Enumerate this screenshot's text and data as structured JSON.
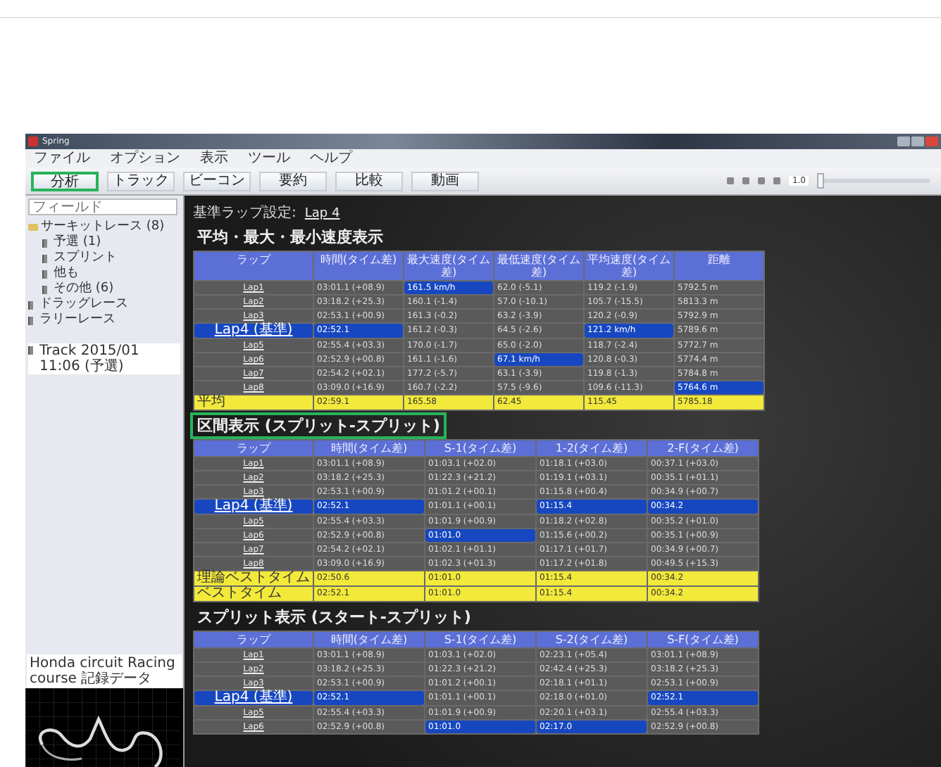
{
  "window": {
    "title": "Spring"
  },
  "menu": [
    "ファイル",
    "オプション",
    "表示",
    "ツール",
    "ヘルプ"
  ],
  "toolbar": {
    "buttons": [
      {
        "label": "分析",
        "outlined": true
      },
      {
        "label": "トラック",
        "outlined": false
      },
      {
        "label": "ビーコン",
        "outlined": false
      },
      {
        "label": "要約",
        "outlined": false
      },
      {
        "label": "比較",
        "outlined": false
      },
      {
        "label": "動画",
        "outlined": false
      }
    ],
    "zoom": "1.0",
    "slider": {
      "level": 0.0
    }
  },
  "sidebar": {
    "search": {
      "placeholder": "フィールド"
    },
    "tree": [
      {
        "label": "サーキットレース (8)",
        "expanded": true,
        "children": [
          {
            "label": "予選 (1)"
          },
          {
            "label": "スプリント"
          },
          {
            "label": "他も"
          },
          {
            "label": "その他 (6)"
          }
        ]
      },
      {
        "label": "ドラッグレース"
      },
      {
        "label": "ラリーレース"
      }
    ],
    "session": "Track 2015/01 11:06 (予選)",
    "map_caption": "Honda circuit Racing course 記録データ"
  },
  "main": {
    "reference_label": "基準ラップ設定:",
    "reference_lap": "Lap 4",
    "sections": [
      {
        "title": "平均・最大・最小速度表示",
        "outlined": false,
        "table": {
          "columns": [
            "ラップ",
            "時間(タイム差)",
            "最大速度(タイム差)",
            "最低速度(タイム差)",
            "平均速度(タイム差)",
            "距離"
          ],
          "rows": [
            {
              "kind": "lap",
              "cells": [
                {
                  "text": "Lap1",
                  "best": false
                },
                {
                  "text": "03:01.1 (+08.9)",
                  "best": false
                },
                {
                  "text": "161.5 km/h",
                  "best": true
                },
                {
                  "text": "62.0 (-5.1)",
                  "best": false
                },
                {
                  "text": "119.2 (-1.9)",
                  "best": false
                },
                {
                  "text": "5792.5 m",
                  "best": false
                }
              ]
            },
            {
              "kind": "lap",
              "cells": [
                {
                  "text": "Lap2",
                  "best": false
                },
                {
                  "text": "03:18.2 (+25.3)",
                  "best": false
                },
                {
                  "text": "160.1 (-1.4)",
                  "best": false
                },
                {
                  "text": "57.0 (-10.1)",
                  "best": false
                },
                {
                  "text": "105.7 (-15.5)",
                  "best": false
                },
                {
                  "text": "5813.3 m",
                  "best": false
                }
              ]
            },
            {
              "kind": "lap",
              "cells": [
                {
                  "text": "Lap3",
                  "best": false
                },
                {
                  "text": "02:53.1 (+00.9)",
                  "best": false
                },
                {
                  "text": "161.3 (-0.2)",
                  "best": false
                },
                {
                  "text": "63.2 (-3.9)",
                  "best": false
                },
                {
                  "text": "120.2 (-0.9)",
                  "best": false
                },
                {
                  "text": "5792.9 m",
                  "best": false
                }
              ]
            },
            {
              "kind": "lap",
              "cells": [
                {
                  "text": "Lap4 (基準)",
                  "best": true
                },
                {
                  "text": "02:52.1",
                  "best": true
                },
                {
                  "text": "161.2 (-0.3)",
                  "best": false
                },
                {
                  "text": "64.5 (-2.6)",
                  "best": false
                },
                {
                  "text": "121.2 km/h",
                  "best": true
                },
                {
                  "text": "5789.6 m",
                  "best": false
                }
              ]
            },
            {
              "kind": "lap",
              "cells": [
                {
                  "text": "Lap5",
                  "best": false
                },
                {
                  "text": "02:55.4 (+03.3)",
                  "best": false
                },
                {
                  "text": "170.0 (-1.7)",
                  "best": false
                },
                {
                  "text": "65.0 (-2.0)",
                  "best": false
                },
                {
                  "text": "118.7 (-2.4)",
                  "best": false
                },
                {
                  "text": "5772.7 m",
                  "best": false
                }
              ]
            },
            {
              "kind": "lap",
              "cells": [
                {
                  "text": "Lap6",
                  "best": false
                },
                {
                  "text": "02:52.9 (+00.8)",
                  "best": false
                },
                {
                  "text": "161.1 (-1.6)",
                  "best": false
                },
                {
                  "text": "67.1 km/h",
                  "best": true
                },
                {
                  "text": "120.8 (-0.3)",
                  "best": false
                },
                {
                  "text": "5774.4 m",
                  "best": false
                }
              ]
            },
            {
              "kind": "lap",
              "cells": [
                {
                  "text": "Lap7",
                  "best": false
                },
                {
                  "text": "02:54.2 (+02.1)",
                  "best": false
                },
                {
                  "text": "177.2 (-5.7)",
                  "best": false
                },
                {
                  "text": "63.1 (-3.9)",
                  "best": false
                },
                {
                  "text": "119.8 (-1.3)",
                  "best": false
                },
                {
                  "text": "5784.8 m",
                  "best": false
                }
              ]
            },
            {
              "kind": "lap",
              "cells": [
                {
                  "text": "Lap8",
                  "best": false
                },
                {
                  "text": "03:09.0 (+16.9)",
                  "best": false
                },
                {
                  "text": "160.7 (-2.2)",
                  "best": false
                },
                {
                  "text": "57.5 (-9.6)",
                  "best": false
                },
                {
                  "text": "109.6 (-11.3)",
                  "best": false
                },
                {
                  "text": "5764.6 m",
                  "best": true
                }
              ]
            },
            {
              "kind": "summary",
              "cells": [
                {
                  "text": "平均",
                  "best": false
                },
                {
                  "text": "02:59.1",
                  "best": false
                },
                {
                  "text": "165.58",
                  "best": false
                },
                {
                  "text": "62.45",
                  "best": false
                },
                {
                  "text": "115.45",
                  "best": false
                },
                {
                  "text": "5785.18",
                  "best": false
                }
              ]
            }
          ]
        }
      },
      {
        "title": "区間表示 (スプリット-スプリット)",
        "outlined": true,
        "table": {
          "columns": [
            "ラップ",
            "時間(タイム差)",
            "S-1(タイム差)",
            "1-2(タイム差)",
            "2-F(タイム差)"
          ],
          "rows": [
            {
              "kind": "lap",
              "cells": [
                {
                  "text": "Lap1",
                  "best": false
                },
                {
                  "text": "03:01.1 (+08.9)",
                  "best": false
                },
                {
                  "text": "01:03.1 (+02.0)",
                  "best": false
                },
                {
                  "text": "01:18.1 (+03.0)",
                  "best": false
                },
                {
                  "text": "00:37.1 (+03.0)",
                  "best": false
                }
              ]
            },
            {
              "kind": "lap",
              "cells": [
                {
                  "text": "Lap2",
                  "best": false
                },
                {
                  "text": "03:18.2 (+25.3)",
                  "best": false
                },
                {
                  "text": "01:22.3 (+21.2)",
                  "best": false
                },
                {
                  "text": "01:19.1 (+03.1)",
                  "best": false
                },
                {
                  "text": "00:35.1 (+01.1)",
                  "best": false
                }
              ]
            },
            {
              "kind": "lap",
              "cells": [
                {
                  "text": "Lap3",
                  "best": false
                },
                {
                  "text": "02:53.1 (+00.9)",
                  "best": false
                },
                {
                  "text": "01:01.2 (+00.1)",
                  "best": false
                },
                {
                  "text": "01:15.8 (+00.4)",
                  "best": false
                },
                {
                  "text": "00:34.9 (+00.7)",
                  "best": false
                }
              ]
            },
            {
              "kind": "lap",
              "cells": [
                {
                  "text": "Lap4 (基準)",
                  "best": true
                },
                {
                  "text": "02:52.1",
                  "best": true
                },
                {
                  "text": "01:01.1 (+00.1)",
                  "best": false
                },
                {
                  "text": "01:15.4",
                  "best": true
                },
                {
                  "text": "00:34.2",
                  "best": true
                }
              ]
            },
            {
              "kind": "lap",
              "cells": [
                {
                  "text": "Lap5",
                  "best": false
                },
                {
                  "text": "02:55.4 (+03.3)",
                  "best": false
                },
                {
                  "text": "01:01.9 (+00.9)",
                  "best": false
                },
                {
                  "text": "01:18.2 (+02.8)",
                  "best": false
                },
                {
                  "text": "00:35.2 (+01.0)",
                  "best": false
                }
              ]
            },
            {
              "kind": "lap",
              "cells": [
                {
                  "text": "Lap6",
                  "best": false
                },
                {
                  "text": "02:52.9 (+00.8)",
                  "best": false
                },
                {
                  "text": "01:01.0",
                  "best": true
                },
                {
                  "text": "01:15.6 (+00.2)",
                  "best": false
                },
                {
                  "text": "00:35.1 (+00.9)",
                  "best": false
                }
              ]
            },
            {
              "kind": "lap",
              "cells": [
                {
                  "text": "Lap7",
                  "best": false
                },
                {
                  "text": "02:54.2 (+02.1)",
                  "best": false
                },
                {
                  "text": "01:02.1 (+01.1)",
                  "best": false
                },
                {
                  "text": "01:17.1 (+01.7)",
                  "best": false
                },
                {
                  "text": "00:34.9 (+00.7)",
                  "best": false
                }
              ]
            },
            {
              "kind": "lap",
              "cells": [
                {
                  "text": "Lap8",
                  "best": false
                },
                {
                  "text": "03:09.0 (+16.9)",
                  "best": false
                },
                {
                  "text": "01:02.3 (+01.3)",
                  "best": false
                },
                {
                  "text": "01:17.2 (+01.8)",
                  "best": false
                },
                {
                  "text": "00:49.5 (+15.3)",
                  "best": false
                }
              ]
            },
            {
              "kind": "summary",
              "cells": [
                {
                  "text": "理論ベストタイム",
                  "best": false
                },
                {
                  "text": "02:50.6",
                  "best": false
                },
                {
                  "text": "01:01.0",
                  "best": false
                },
                {
                  "text": "01:15.4",
                  "best": false
                },
                {
                  "text": "00:34.2",
                  "best": false
                }
              ]
            },
            {
              "kind": "summary",
              "cells": [
                {
                  "text": "ベストタイム",
                  "best": false
                },
                {
                  "text": "02:52.1",
                  "best": false
                },
                {
                  "text": "01:01.0",
                  "best": false
                },
                {
                  "text": "01:15.4",
                  "best": false
                },
                {
                  "text": "00:34.2",
                  "best": false
                }
              ]
            }
          ]
        }
      },
      {
        "title": "スプリット表示 (スタート-スプリット)",
        "outlined": false,
        "table": {
          "columns": [
            "ラップ",
            "時間(タイム差)",
            "S-1(タイム差)",
            "S-2(タイム差)",
            "S-F(タイム差)"
          ],
          "rows": [
            {
              "kind": "lap",
              "cells": [
                {
                  "text": "Lap1",
                  "best": false
                },
                {
                  "text": "03:01.1 (+08.9)",
                  "best": false
                },
                {
                  "text": "01:03.1 (+02.0)",
                  "best": false
                },
                {
                  "text": "02:23.1 (+05.4)",
                  "best": false
                },
                {
                  "text": "03:01.1 (+08.9)",
                  "best": false
                }
              ]
            },
            {
              "kind": "lap",
              "cells": [
                {
                  "text": "Lap2",
                  "best": false
                },
                {
                  "text": "03:18.2 (+25.3)",
                  "best": false
                },
                {
                  "text": "01:22.3 (+21.2)",
                  "best": false
                },
                {
                  "text": "02:42.4 (+25.3)",
                  "best": false
                },
                {
                  "text": "03:18.2 (+25.3)",
                  "best": false
                }
              ]
            },
            {
              "kind": "lap",
              "cells": [
                {
                  "text": "Lap3",
                  "best": false
                },
                {
                  "text": "02:53.1 (+00.9)",
                  "best": false
                },
                {
                  "text": "01:01.2 (+00.1)",
                  "best": false
                },
                {
                  "text": "02:18.1 (+01.1)",
                  "best": false
                },
                {
                  "text": "02:53.1 (+00.9)",
                  "best": false
                }
              ]
            },
            {
              "kind": "lap",
              "cells": [
                {
                  "text": "Lap4 (基準)",
                  "best": true
                },
                {
                  "text": "02:52.1",
                  "best": true
                },
                {
                  "text": "01:01.1 (+00.1)",
                  "best": false
                },
                {
                  "text": "02:18.0 (+01.0)",
                  "best": false
                },
                {
                  "text": "02:52.1",
                  "best": true
                }
              ]
            },
            {
              "kind": "lap",
              "cells": [
                {
                  "text": "Lap5",
                  "best": false
                },
                {
                  "text": "02:55.4 (+03.3)",
                  "best": false
                },
                {
                  "text": "01:01.9 (+00.9)",
                  "best": false
                },
                {
                  "text": "02:20.1 (+03.1)",
                  "best": false
                },
                {
                  "text": "02:55.4 (+03.3)",
                  "best": false
                }
              ]
            },
            {
              "kind": "lap",
              "cells": [
                {
                  "text": "Lap6",
                  "best": false
                },
                {
                  "text": "02:52.9 (+00.8)",
                  "best": false
                },
                {
                  "text": "01:01.0",
                  "best": true
                },
                {
                  "text": "02:17.0",
                  "best": true
                },
                {
                  "text": "02:52.9 (+00.8)",
                  "best": false
                }
              ]
            }
          ]
        }
      }
    ]
  }
}
